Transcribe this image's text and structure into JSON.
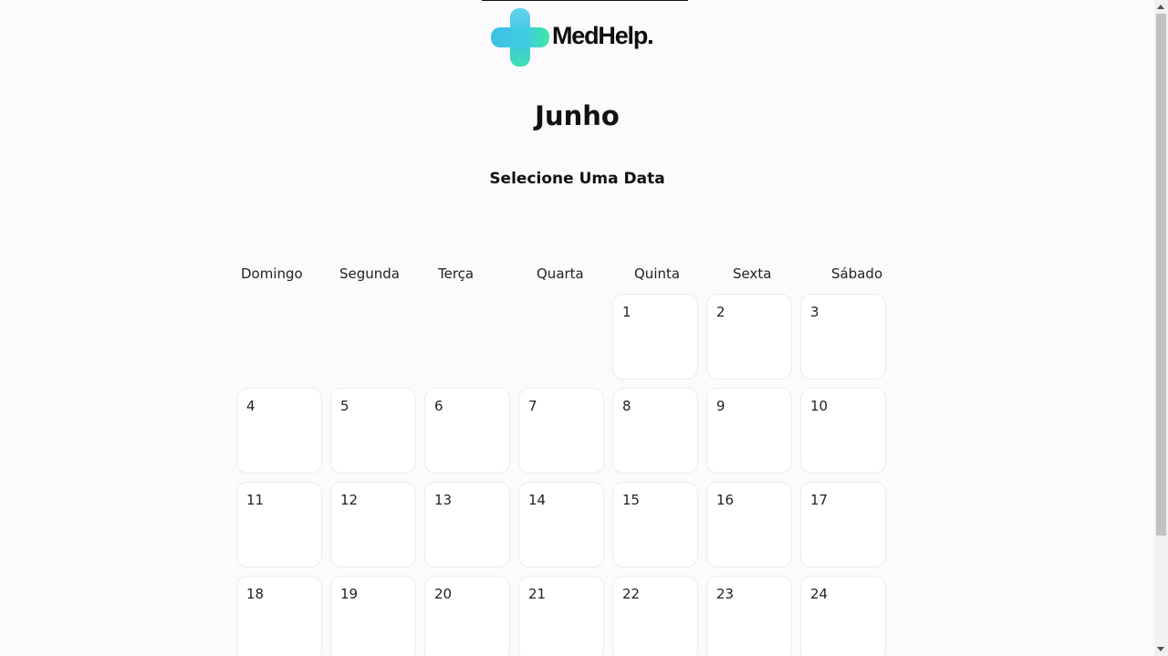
{
  "brand": {
    "name": "MedHelp.",
    "logo_icon": "medical-cross-icon",
    "colors": {
      "cross_top": "#5fd6e6",
      "cross_mid": "#3fc4e0",
      "cross_bottom": "#36e0a8"
    }
  },
  "calendar": {
    "month": "Junho",
    "prompt": "Selecione Uma Data",
    "weekdays": [
      "Domingo",
      "Segunda",
      "Terça",
      "Quarta",
      "Quinta",
      "Sexta",
      "Sábado"
    ],
    "rows": [
      [
        null,
        null,
        null,
        null,
        "1",
        "2",
        "3"
      ],
      [
        "4",
        "5",
        "6",
        "7",
        "8",
        "9",
        "10"
      ],
      [
        "11",
        "12",
        "13",
        "14",
        "15",
        "16",
        "17"
      ],
      [
        "18",
        "19",
        "20",
        "21",
        "22",
        "23",
        "24"
      ]
    ]
  }
}
